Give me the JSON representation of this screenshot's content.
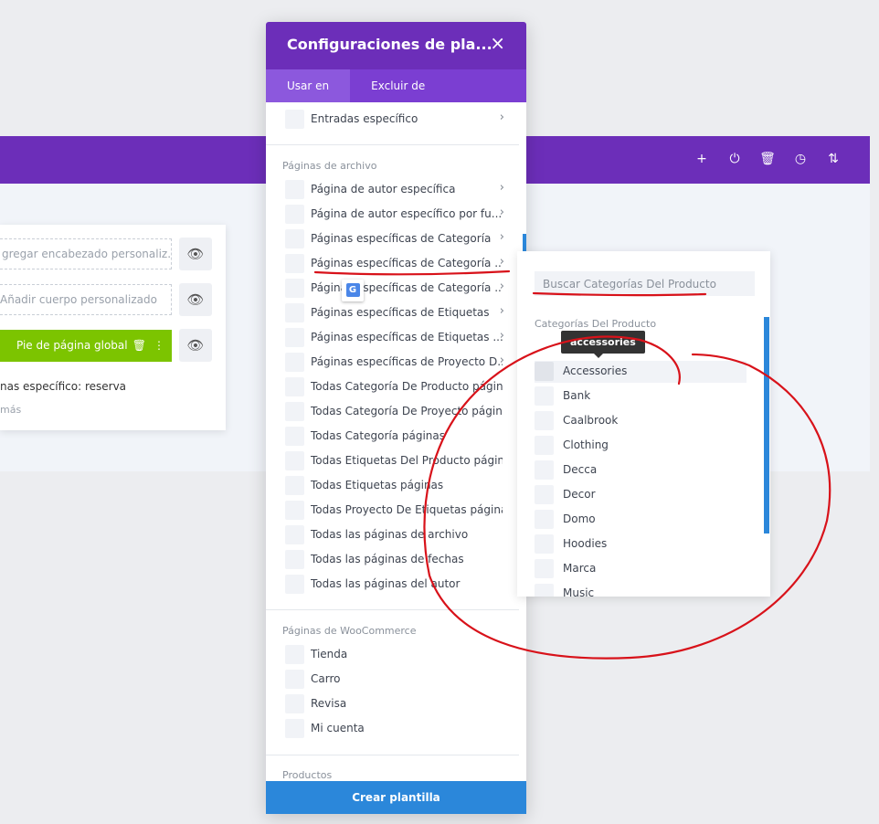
{
  "builder": {
    "tools": [
      {
        "icon": "plus-icon",
        "glyph": "+"
      },
      {
        "icon": "power-icon",
        "glyph": "⏻"
      },
      {
        "icon": "trash-icon",
        "glyph": "🗑"
      },
      {
        "icon": "history-icon",
        "glyph": "◷"
      },
      {
        "icon": "sort-icon",
        "glyph": "⇅"
      }
    ],
    "header_field": "gregar encabezado personaliz...",
    "body_field": "Añadir cuerpo personalizado",
    "footer_label": "Pie de página global",
    "assignment_text": "nas específico: reserva",
    "more_text": "más"
  },
  "modal": {
    "title": "Configuraciones de pla...",
    "close": "×",
    "tabs": [
      "Usar en",
      "Excluir de"
    ],
    "top_item": "Entradas específico",
    "archive_section": "Páginas de archivo",
    "archive_items": [
      "Página de autor específica",
      "Página de autor específico por fu...",
      "Páginas específicas de Categoría",
      "Páginas específicas de Categoría ...",
      "Páginas específicas de Categoría ...",
      "Páginas específicas de Etiquetas",
      "Páginas específicas de Etiquetas ...",
      "Páginas específicas de Proyecto D...",
      "Todas Categoría De Producto páginas",
      "Todas Categoría De Proyecto páginas",
      "Todas Categoría páginas",
      "Todas Etiquetas Del Producto páginas",
      "Todas Etiquetas páginas",
      "Todas Proyecto De Etiquetas páginas",
      "Todas las páginas de archivo",
      "Todas las páginas de fechas",
      "Todas las páginas del autor"
    ],
    "woo_section": "Páginas de WooCommerce",
    "woo_items": [
      "Tienda",
      "Carro",
      "Revisa",
      "Mi cuenta"
    ],
    "products_section": "Productos",
    "create_button": "Crear plantilla"
  },
  "category_panel": {
    "search_placeholder": "Buscar Categorías Del Producto",
    "heading": "Categorías Del Producto",
    "tooltip": "accessories",
    "items": [
      "Accessories",
      "Bank",
      "Caalbrook",
      "Clothing",
      "Decca",
      "Decor",
      "Domo",
      "Hoodies",
      "Marca",
      "Music"
    ]
  },
  "colors": {
    "purple": "#6c2eb9",
    "blue": "#2b87da",
    "green": "#7cc400",
    "annotation": "#d8121a"
  }
}
